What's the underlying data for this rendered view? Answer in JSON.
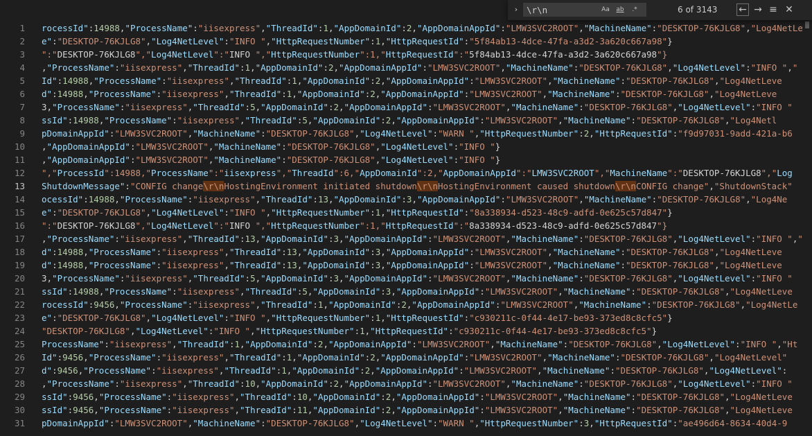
{
  "find_widget": {
    "toggle_glyph": "›",
    "query": "\\r\\n",
    "option_match_case": "Aa",
    "option_whole_word": "ab",
    "option_regex": ".*",
    "count_text": "6 of 3143",
    "prev_glyph": "←",
    "next_glyph": "→",
    "selection_glyph": "≡",
    "close_glyph": "✕"
  },
  "editor": {
    "current_line": 13,
    "lines": [
      {
        "n": "1",
        "t": "rocessId\":14988,\"ProcessName\":\"iisexpress\",\"ThreadId\":1,\"AppDomainId\":2,\"AppDomainAppId\":\"LMW3SVC2ROOT\",\"MachineName\":\"DESKTOP-76KJLG8\",\"Log4NetLeve"
      },
      {
        "n": "2",
        "t": "e\":\"DESKTOP-76KJLG8\",\"Log4NetLevel\":\"INFO \",\"HttpRequestNumber\":1,\"HttpRequestId\":\"5f84ab13-4dce-47fa-a3d2-3a620c667a98\"}"
      },
      {
        "n": "3",
        "t": "\":\"DESKTOP-76KJLG8\",\"Log4NetLevel\":\"INFO \",\"HttpRequestNumber\":1,\"HttpRequestId\":\"5f84ab13-4dce-47fa-a3d2-3a620c667a98\"}"
      },
      {
        "n": "4",
        "t": ",\"ProcessName\":\"iisexpress\",\"ThreadId\":1,\"AppDomainId\":2,\"AppDomainAppId\":\"LMW3SVC2ROOT\",\"MachineName\":\"DESKTOP-76KJLG8\",\"Log4NetLevel\":\"INFO \",\""
      },
      {
        "n": "5",
        "t": "Id\":14988,\"ProcessName\":\"iisexpress\",\"ThreadId\":1,\"AppDomainId\":2,\"AppDomainAppId\":\"LMW3SVC2ROOT\",\"MachineName\":\"DESKTOP-76KJLG8\",\"Log4NetLeve"
      },
      {
        "n": "6",
        "t": "d\":14988,\"ProcessName\":\"iisexpress\",\"ThreadId\":1,\"AppDomainId\":2,\"AppDomainAppId\":\"LMW3SVC2ROOT\",\"MachineName\":\"DESKTOP-76KJLG8\",\"Log4NetLeve"
      },
      {
        "n": "7",
        "t": "3,\"ProcessName\":\"iisexpress\",\"ThreadId\":5,\"AppDomainId\":2,\"AppDomainAppId\":\"LMW3SVC2ROOT\",\"MachineName\":\"DESKTOP-76KJLG8\",\"Log4NetLevel\":\"INFO \""
      },
      {
        "n": "8",
        "t": "ssId\":14988,\"ProcessName\":\"iisexpress\",\"ThreadId\":5,\"AppDomainId\":2,\"AppDomainAppId\":\"LMW3SVC2ROOT\",\"MachineName\":\"DESKTOP-76KJLG8\",\"Log4Netl"
      },
      {
        "n": "9",
        "t": "pDomainAppId\":\"LMW3SVC2ROOT\",\"MachineName\":\"DESKTOP-76KJLG8\",\"Log4NetLevel\":\"WARN \",\"HttpRequestNumber\":2,\"HttpRequestId\":\"f9d97031-9add-421a-b6"
      },
      {
        "n": "10",
        "t": ",\"AppDomainAppId\":\"LMW3SVC2ROOT\",\"MachineName\":\"DESKTOP-76KJLG8\",\"Log4NetLevel\":\"INFO \"}"
      },
      {
        "n": "11",
        "t": ",\"AppDomainAppId\":\"LMW3SVC2ROOT\",\"MachineName\":\"DESKTOP-76KJLG8\",\"Log4NetLevel\":\"INFO \"}"
      },
      {
        "n": "12",
        "t": "\",\"ProcessId\":14988,\"ProcessName\":\"iisexpress\",\"ThreadId\":6,\"AppDomainId\":2,\"AppDomainAppId\":\"LMW3SVC2ROOT\",\"MachineName\":\"DESKTOP-76KJLG8\",\"Log"
      },
      {
        "n": "13",
        "t": "ShutdownMessage\":\"CONFIG change\\r\\nHostingEnvironment initiated shutdown\\r\\nHostingEnvironment caused shutdown\\r\\nCONFIG change\",\"ShutdownStack\""
      },
      {
        "n": "14",
        "t": "ocessId\":14988,\"ProcessName\":\"iisexpress\",\"ThreadId\":13,\"AppDomainId\":3,\"AppDomainAppId\":\"LMW3SVC2ROOT\",\"MachineName\":\"DESKTOP-76KJLG8\",\"Log4Ne"
      },
      {
        "n": "15",
        "t": "e\":\"DESKTOP-76KJLG8\",\"Log4NetLevel\":\"INFO \",\"HttpRequestNumber\":1,\"HttpRequestId\":\"8a338934-d523-48c9-adfd-0e625c57d847\"}"
      },
      {
        "n": "16",
        "t": "\":\"DESKTOP-76KJLG8\",\"Log4NetLevel\":\"INFO \",\"HttpRequestNumber\":1,\"HttpRequestId\":\"8a338934-d523-48c9-adfd-0e625c57d847\"}"
      },
      {
        "n": "17",
        "t": ",\"ProcessName\":\"iisexpress\",\"ThreadId\":13,\"AppDomainId\":3,\"AppDomainAppId\":\"LMW3SVC2ROOT\",\"MachineName\":\"DESKTOP-76KJLG8\",\"Log4NetLevel\":\"INFO \",\""
      },
      {
        "n": "18",
        "t": "d\":14988,\"ProcessName\":\"iisexpress\",\"ThreadId\":13,\"AppDomainId\":3,\"AppDomainAppId\":\"LMW3SVC2ROOT\",\"MachineName\":\"DESKTOP-76KJLG8\",\"Log4NetLeve"
      },
      {
        "n": "19",
        "t": "d\":14988,\"ProcessName\":\"iisexpress\",\"ThreadId\":13,\"AppDomainId\":3,\"AppDomainAppId\":\"LMW3SVC2ROOT\",\"MachineName\":\"DESKTOP-76KJLG8\",\"Log4NetLeve"
      },
      {
        "n": "20",
        "t": "3,\"ProcessName\":\"iisexpress\",\"ThreadId\":5,\"AppDomainId\":3,\"AppDomainAppId\":\"LMW3SVC2ROOT\",\"MachineName\":\"DESKTOP-76KJLG8\",\"Log4NetLevel\":\"INFO \""
      },
      {
        "n": "21",
        "t": "ssId\":14988,\"ProcessName\":\"iisexpress\",\"ThreadId\":5,\"AppDomainId\":3,\"AppDomainAppId\":\"LMW3SVC2ROOT\",\"MachineName\":\"DESKTOP-76KJLG8\",\"Log4NetLeve"
      },
      {
        "n": "22",
        "t": "rocessId\":9456,\"ProcessName\":\"iisexpress\",\"ThreadId\":1,\"AppDomainId\":2,\"AppDomainAppId\":\"LMW3SVC2ROOT\",\"MachineName\":\"DESKTOP-76KJLG8\",\"Log4NetLe"
      },
      {
        "n": "23",
        "t": "e\":\"DESKTOP-76KJLG8\",\"Log4NetLevel\":\"INFO \",\"HttpRequestNumber\":1,\"HttpRequestId\":\"c930211c-0f44-4e17-be93-373ed8c8cfc5\"}"
      },
      {
        "n": "24",
        "t": "\"DESKTOP-76KJLG8\",\"Log4NetLevel\":\"INFO \",\"HttpRequestNumber\":1,\"HttpRequestId\":\"c930211c-0f44-4e17-be93-373ed8c8cfc5\"}"
      },
      {
        "n": "25",
        "t": "ProcessName\":\"iisexpress\",\"ThreadId\":1,\"AppDomainId\":2,\"AppDomainAppId\":\"LMW3SVC2ROOT\",\"MachineName\":\"DESKTOP-76KJLG8\",\"Log4NetLevel\":\"INFO \",\"Ht"
      },
      {
        "n": "26",
        "t": "Id\":9456,\"ProcessName\":\"iisexpress\",\"ThreadId\":1,\"AppDomainId\":2,\"AppDomainAppId\":\"LMW3SVC2ROOT\",\"MachineName\":\"DESKTOP-76KJLG8\",\"Log4NetLevel\""
      },
      {
        "n": "27",
        "t": "d\":9456,\"ProcessName\":\"iisexpress\",\"ThreadId\":1,\"AppDomainId\":2,\"AppDomainAppId\":\"LMW3SVC2ROOT\",\"MachineName\":\"DESKTOP-76KJLG8\",\"Log4NetLevel\":"
      },
      {
        "n": "28",
        "t": ",\"ProcessName\":\"iisexpress\",\"ThreadId\":10,\"AppDomainId\":2,\"AppDomainAppId\":\"LMW3SVC2ROOT\",\"MachineName\":\"DESKTOP-76KJLG8\",\"Log4NetLevel\":\"INFO \""
      },
      {
        "n": "29",
        "t": "ssId\":9456,\"ProcessName\":\"iisexpress\",\"ThreadId\":10,\"AppDomainId\":2,\"AppDomainAppId\":\"LMW3SVC2ROOT\",\"MachineName\":\"DESKTOP-76KJLG8\",\"Log4NetLeve"
      },
      {
        "n": "30",
        "t": "ssId\":9456,\"ProcessName\":\"iisexpress\",\"ThreadId\":11,\"AppDomainId\":2,\"AppDomainAppId\":\"LMW3SVC2ROOT\",\"MachineName\":\"DESKTOP-76KJLG8\",\"Log4NetLeve"
      },
      {
        "n": "31",
        "t": "pDomainAppId\":\"LMW3SVC2ROOT\",\"MachineName\":\"DESKTOP-76KJLG8\",\"Log4NetLevel\":\"WARN \",\"HttpRequestNumber\":3,\"HttpRequestId\":\"ae496d64-8634-40d4-9"
      }
    ]
  }
}
